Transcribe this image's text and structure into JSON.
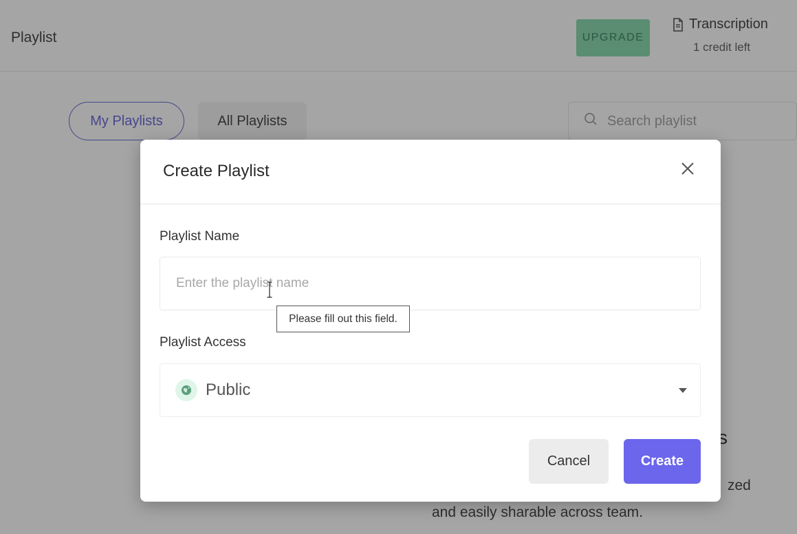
{
  "header": {
    "title": "Playlist",
    "upgrade_label": "UPGRADE",
    "transcription_label": "Transcription",
    "credits_text": "1 credit left"
  },
  "tabs": [
    {
      "label": "My Playlists",
      "active": true
    },
    {
      "label": "All Playlists",
      "active": false
    }
  ],
  "search": {
    "placeholder": "Search playlist"
  },
  "empty_state": {
    "heading_fragment": "s",
    "line1_fragment": "zed",
    "line2": "and easily sharable across team."
  },
  "modal": {
    "title": "Create Playlist",
    "name_label": "Playlist Name",
    "name_placeholder": "Enter the playlist name",
    "name_value": "",
    "validation_tooltip": "Please fill out this field.",
    "access_label": "Playlist Access",
    "access_value": "Public",
    "cancel_label": "Cancel",
    "create_label": "Create"
  },
  "colors": {
    "accent": "#6b66ec",
    "upgrade_bg": "#7fd6a7",
    "public_badge": "#dff5ea"
  },
  "icons": {
    "close": "close-icon",
    "search": "search-icon",
    "document": "document-icon",
    "globe": "globe-icon",
    "caret": "caret-down-icon"
  }
}
